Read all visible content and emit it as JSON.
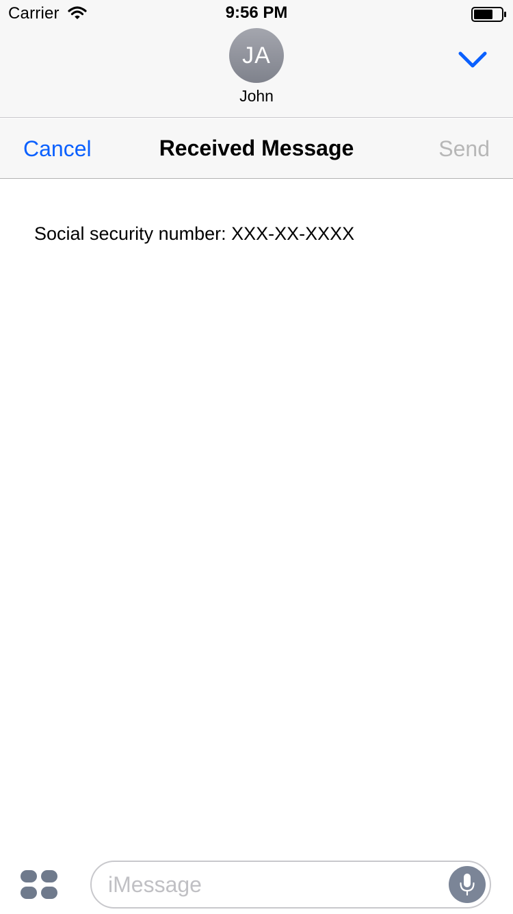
{
  "status_bar": {
    "carrier": "Carrier",
    "time": "9:56 PM",
    "icons": [
      "wifi-icon",
      "battery-icon"
    ]
  },
  "conversation": {
    "avatar_initials": "JA",
    "contact_name": "John",
    "expand_icon": "chevron-down-icon"
  },
  "nav": {
    "cancel_label": "Cancel",
    "title": "Received Message",
    "send_label": "Send"
  },
  "message": {
    "text": "Social security number: XXX-XX-XXXX"
  },
  "input_bar": {
    "apps_icon": "apps-icon",
    "placeholder": "iMessage",
    "value": "",
    "mic_icon": "microphone-icon"
  },
  "colors": {
    "accent": "#0a60fe",
    "disabled": "#b7b7b7",
    "bar_background": "#f7f7f7",
    "avatar": "#8e919a",
    "mic_button": "#7b8597"
  }
}
